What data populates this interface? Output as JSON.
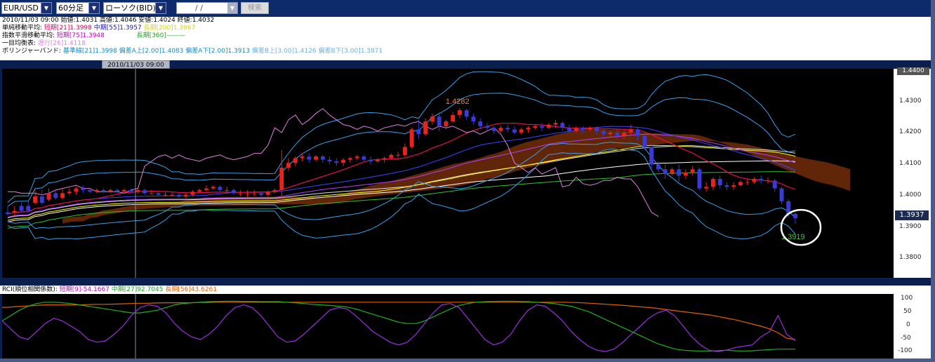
{
  "toolbar": {
    "symbol": "EUR/USD",
    "timeframe": "60分足",
    "chart_type": "ローソク(BID)",
    "date_placeholder": "/ /",
    "search_label": "検索",
    "dropdown_glyph": "▼"
  },
  "info": {
    "ohlc": "2010/11/03 09:00  始値:1.4031  高値:1.4046  安値:1.4024  終値:1.4032",
    "sma_label": "単純移動平均:",
    "sma_short": "短期[21]1.3998",
    "sma_mid": "中期[55]1.3957",
    "sma_long": "長期[200]1.3967",
    "ema_label": "指数平滑移動平均:",
    "ema_short": "短期[75]1.3948",
    "ema_long": "長期[360]",
    "ichimoku_label": "一目均衡表:",
    "ichimoku_val": "遅行[26]1.4118",
    "bb_label": "ボリンジャーバンド:",
    "bb_base": "基準線[21]1.3998",
    "bb_a_up": "偏差A上[2.00]1.4083",
    "bb_a_dn": "偏差A下[2.00]1.3913",
    "bb_b_up": "偏差B上[3.00]1.4126",
    "bb_b_dn": "偏差B下[3.00]1.3871"
  },
  "date_marker": "2010/11/03 09:00",
  "main_axis": {
    "top_label": "1.4400",
    "ticks": [
      "1.4300",
      "1.4200",
      "1.4100",
      "1.4000",
      "1.3900",
      "1.3800"
    ],
    "current_price": "1.3937"
  },
  "annotations": {
    "high": "1.4282",
    "low": "1.3919"
  },
  "sub_title": {
    "label": "RCI(順位相関係数):",
    "short": "短期[9]-54.1667",
    "mid": "中期[27]92.7045",
    "long": "長期[56]43.6261"
  },
  "sub_axis": {
    "ticks": [
      "100",
      "50",
      "0",
      "-50",
      "-100"
    ]
  },
  "colors": {
    "bull": "#e8231f",
    "bear": "#3a3ad8",
    "sma_short": "#e01050",
    "sma_mid": "#4040ff",
    "sma_long": "#ffff00",
    "ema_short": "#b040ff",
    "ema_long": "#30c030",
    "chikou": "#e080e0",
    "bb": "#3aa0e8",
    "cloud": "#6b2a08",
    "white_line": "#ffffff"
  },
  "chart_data": {
    "type": "candlestick",
    "ylim": [
      1.375,
      1.4405
    ],
    "candles": [
      [
        1.3955,
        1.3975,
        1.395,
        1.3945
      ],
      [
        1.3955,
        1.3975,
        1.396,
        1.3945
      ],
      [
        1.3975,
        1.3985,
        1.396,
        1.3955
      ],
      [
        1.3975,
        1.399,
        1.396,
        1.3955
      ],
      [
        1.3985,
        1.403,
        1.4005,
        1.398
      ],
      [
        1.4005,
        1.4025,
        1.3985,
        1.398
      ],
      [
        1.3995,
        1.403,
        1.4015,
        1.399
      ],
      [
        1.4015,
        1.4025,
        1.4,
        1.3995
      ],
      [
        1.4,
        1.403,
        1.4015,
        1.3995
      ],
      [
        1.4015,
        1.403,
        1.402,
        1.401
      ],
      [
        1.402,
        1.4035,
        1.403,
        1.401
      ],
      [
        1.403,
        1.404,
        1.4025,
        1.4015
      ],
      [
        1.4025,
        1.403,
        1.402,
        1.4015
      ],
      [
        1.402,
        1.403,
        1.4025,
        1.4015
      ],
      [
        1.4025,
        1.403,
        1.402,
        1.4015
      ],
      [
        1.402,
        1.403,
        1.4025,
        1.4015
      ],
      [
        1.4025,
        1.403,
        1.402,
        1.4015
      ],
      [
        1.402,
        1.403,
        1.4025,
        1.402
      ],
      [
        1.4025,
        1.403,
        1.402,
        1.4015
      ],
      [
        1.402,
        1.403,
        1.4025,
        1.4015
      ],
      [
        1.4025,
        1.403,
        1.4015,
        1.401
      ],
      [
        1.4015,
        1.4025,
        1.4015,
        1.401
      ],
      [
        1.4015,
        1.402,
        1.401,
        1.4005
      ],
      [
        1.401,
        1.402,
        1.401,
        1.4005
      ],
      [
        1.401,
        1.402,
        1.401,
        1.4005
      ],
      [
        1.401,
        1.4015,
        1.4005,
        1.4
      ],
      [
        1.4005,
        1.4015,
        1.401,
        1.4
      ],
      [
        1.401,
        1.4025,
        1.402,
        1.4005
      ],
      [
        1.402,
        1.403,
        1.4025,
        1.4015
      ],
      [
        1.4025,
        1.404,
        1.403,
        1.402
      ],
      [
        1.403,
        1.404,
        1.4035,
        1.4025
      ],
      [
        1.4035,
        1.404,
        1.4025,
        1.402
      ],
      [
        1.4025,
        1.4035,
        1.4025,
        1.4015
      ],
      [
        1.4025,
        1.403,
        1.4015,
        1.401
      ],
      [
        1.4015,
        1.4025,
        1.4015,
        1.4005
      ],
      [
        1.4015,
        1.4025,
        1.4015,
        1.4
      ],
      [
        1.4015,
        1.4025,
        1.4015,
        1.4005
      ],
      [
        1.4015,
        1.402,
        1.401,
        1.4
      ],
      [
        1.401,
        1.4025,
        1.402,
        1.4005
      ],
      [
        1.402,
        1.403,
        1.4025,
        1.4015
      ],
      [
        1.4025,
        1.415,
        1.4095,
        1.399
      ],
      [
        1.4095,
        1.4125,
        1.411,
        1.4085
      ],
      [
        1.411,
        1.413,
        1.4125,
        1.41
      ],
      [
        1.4125,
        1.414,
        1.413,
        1.4115
      ],
      [
        1.413,
        1.414,
        1.412,
        1.411
      ],
      [
        1.412,
        1.4135,
        1.413,
        1.4115
      ],
      [
        1.413,
        1.4135,
        1.412,
        1.411
      ],
      [
        1.412,
        1.413,
        1.4115,
        1.4105
      ],
      [
        1.4115,
        1.4125,
        1.411,
        1.41
      ],
      [
        1.411,
        1.4125,
        1.412,
        1.41
      ],
      [
        1.412,
        1.413,
        1.4125,
        1.411
      ],
      [
        1.4125,
        1.4135,
        1.413,
        1.412
      ],
      [
        1.413,
        1.4135,
        1.412,
        1.4115
      ],
      [
        1.412,
        1.413,
        1.4115,
        1.4105
      ],
      [
        1.4115,
        1.4125,
        1.412,
        1.411
      ],
      [
        1.412,
        1.413,
        1.4125,
        1.411
      ],
      [
        1.4125,
        1.414,
        1.4135,
        1.412
      ],
      [
        1.4135,
        1.4145,
        1.4135,
        1.4125
      ],
      [
        1.4135,
        1.417,
        1.416,
        1.413
      ],
      [
        1.416,
        1.422,
        1.4215,
        1.4155
      ],
      [
        1.4215,
        1.4245,
        1.42,
        1.4185
      ],
      [
        1.42,
        1.425,
        1.424,
        1.4195
      ],
      [
        1.424,
        1.4265,
        1.4255,
        1.423
      ],
      [
        1.4255,
        1.427,
        1.4225,
        1.421
      ],
      [
        1.4225,
        1.4245,
        1.424,
        1.4215
      ],
      [
        1.424,
        1.427,
        1.426,
        1.4235
      ],
      [
        1.426,
        1.4282,
        1.4275,
        1.425
      ],
      [
        1.4275,
        1.428,
        1.4255,
        1.4245
      ],
      [
        1.4255,
        1.4265,
        1.424,
        1.423
      ],
      [
        1.424,
        1.425,
        1.4225,
        1.4215
      ],
      [
        1.4225,
        1.4235,
        1.422,
        1.421
      ],
      [
        1.422,
        1.4225,
        1.421,
        1.42
      ],
      [
        1.421,
        1.4225,
        1.422,
        1.4205
      ],
      [
        1.422,
        1.423,
        1.4215,
        1.4205
      ],
      [
        1.4215,
        1.4225,
        1.4205,
        1.42
      ],
      [
        1.4205,
        1.422,
        1.4215,
        1.42
      ],
      [
        1.4215,
        1.4225,
        1.422,
        1.4205
      ],
      [
        1.422,
        1.423,
        1.4225,
        1.4215
      ],
      [
        1.4225,
        1.4235,
        1.422,
        1.421
      ],
      [
        1.422,
        1.4235,
        1.423,
        1.4215
      ],
      [
        1.423,
        1.4245,
        1.4235,
        1.422
      ],
      [
        1.4235,
        1.424,
        1.422,
        1.421
      ],
      [
        1.422,
        1.423,
        1.421,
        1.4205
      ],
      [
        1.421,
        1.4225,
        1.422,
        1.4205
      ],
      [
        1.422,
        1.4225,
        1.4215,
        1.4205
      ],
      [
        1.4215,
        1.4225,
        1.422,
        1.421
      ],
      [
        1.422,
        1.4225,
        1.421,
        1.42
      ],
      [
        1.421,
        1.4215,
        1.42,
        1.419
      ],
      [
        1.42,
        1.421,
        1.4205,
        1.419
      ],
      [
        1.4205,
        1.4215,
        1.4195,
        1.4185
      ],
      [
        1.4195,
        1.421,
        1.4205,
        1.4185
      ],
      [
        1.4205,
        1.423,
        1.4215,
        1.4195
      ],
      [
        1.4215,
        1.422,
        1.4195,
        1.418
      ],
      [
        1.4195,
        1.42,
        1.416,
        1.415
      ],
      [
        1.416,
        1.417,
        1.4105,
        1.4085
      ],
      [
        1.4105,
        1.4115,
        1.409,
        1.408
      ],
      [
        1.409,
        1.4105,
        1.4075,
        1.406
      ],
      [
        1.4075,
        1.4095,
        1.409,
        1.407
      ],
      [
        1.409,
        1.4105,
        1.407,
        1.405
      ],
      [
        1.407,
        1.409,
        1.408,
        1.406
      ],
      [
        1.408,
        1.41,
        1.409,
        1.407
      ],
      [
        1.409,
        1.4095,
        1.403,
        1.4025
      ],
      [
        1.403,
        1.405,
        1.4035,
        1.402
      ],
      [
        1.4035,
        1.4065,
        1.406,
        1.4025
      ],
      [
        1.406,
        1.407,
        1.404,
        1.403
      ],
      [
        1.404,
        1.405,
        1.4035,
        1.4025
      ],
      [
        1.4035,
        1.405,
        1.404,
        1.4025
      ],
      [
        1.404,
        1.4055,
        1.405,
        1.4035
      ],
      [
        1.405,
        1.406,
        1.405,
        1.404
      ],
      [
        1.405,
        1.4065,
        1.406,
        1.4045
      ],
      [
        1.406,
        1.407,
        1.4055,
        1.4045
      ],
      [
        1.4055,
        1.4065,
        1.4055,
        1.4045
      ],
      [
        1.4055,
        1.406,
        1.403,
        1.402
      ],
      [
        1.403,
        1.4035,
        1.399,
        1.398
      ],
      [
        1.399,
        1.3995,
        1.395,
        1.394
      ],
      [
        1.395,
        1.396,
        1.3937,
        1.3919
      ]
    ]
  },
  "rci_data": {
    "short": [
      20,
      -10,
      -40,
      -50,
      -20,
      10,
      30,
      20,
      0,
      -20,
      -50,
      -60,
      -55,
      -30,
      0,
      40,
      70,
      80,
      75,
      50,
      10,
      -20,
      -40,
      -50,
      -30,
      0,
      40,
      70,
      80,
      70,
      40,
      0,
      -40,
      -60,
      -55,
      -30,
      0,
      30,
      60,
      70,
      65,
      40,
      10,
      -20,
      -40,
      -60,
      -70,
      -60,
      -30,
      10,
      50,
      80,
      85,
      70,
      30,
      -10,
      -50,
      -70,
      -60,
      -30,
      20,
      60,
      80,
      75,
      50,
      20,
      -20,
      -50,
      -75,
      -90,
      -95,
      -85,
      -60,
      -30,
      0,
      30,
      50,
      60,
      40,
      0,
      -40,
      -70,
      -90,
      -95,
      -90,
      -80,
      -75,
      -70,
      -40,
      -20,
      40,
      -30,
      -54
    ],
    "mid": [
      20,
      40,
      60,
      75,
      85,
      90,
      90,
      88,
      85,
      80,
      75,
      70,
      65,
      60,
      55,
      50,
      50,
      55,
      60,
      70,
      80,
      85,
      88,
      90,
      92,
      93,
      94,
      94,
      93,
      93,
      92,
      92,
      92,
      90,
      88,
      85,
      82,
      80,
      78,
      75,
      72,
      65,
      55,
      45,
      35,
      25,
      15,
      10,
      10,
      20,
      35,
      50,
      65,
      78,
      85,
      90,
      92,
      93,
      94,
      94,
      93,
      92,
      90,
      88,
      85,
      80,
      75,
      65,
      55,
      40,
      25,
      10,
      -5,
      -20,
      -35,
      -50,
      -65,
      -75,
      -85,
      -90,
      -92,
      -93,
      -93,
      -92,
      -90,
      -92,
      -93,
      -92,
      -90,
      -88,
      -86,
      -86,
      -86
    ],
    "long": [
      70,
      72,
      74,
      76,
      78,
      80,
      80,
      80,
      80,
      80,
      81,
      82,
      82,
      83,
      84,
      85,
      86,
      86,
      87,
      88,
      88,
      88,
      88,
      89,
      89,
      90,
      90,
      90,
      90,
      90,
      90,
      90,
      90,
      90,
      90,
      90,
      90,
      90,
      90,
      90,
      90,
      90,
      90,
      90,
      90,
      90,
      90,
      90,
      90,
      90,
      90,
      90,
      90,
      90,
      90,
      90,
      90,
      90,
      90,
      90,
      90,
      90,
      90,
      90,
      90,
      90,
      90,
      89,
      88,
      86,
      84,
      82,
      80,
      78,
      75,
      72,
      70,
      66,
      62,
      58,
      54,
      50,
      46,
      42,
      36,
      30,
      24,
      16,
      8,
      0,
      -10,
      -25,
      -45,
      -50
    ]
  }
}
